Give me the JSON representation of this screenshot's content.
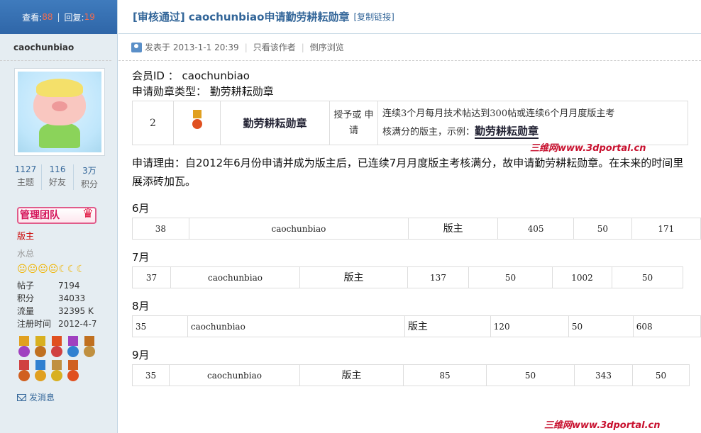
{
  "sidebar": {
    "views_label": "查看:",
    "views": "88",
    "replies_label": "回复:",
    "replies": "19",
    "username": "caochunbiao",
    "stats": [
      {
        "value": "1127",
        "label": "主题"
      },
      {
        "value": "116",
        "label": "好友"
      },
      {
        "value": "3万",
        "label": "积分"
      }
    ],
    "badge": "管理团队",
    "role": "版主",
    "group": "水总",
    "level_icons": "😐😐😐😐☾☾☾",
    "info": [
      {
        "label": "帖子",
        "value": "7194"
      },
      {
        "label": "积分",
        "value": "34033"
      },
      {
        "label": "流量",
        "value": "32395 K"
      },
      {
        "label": "注册时间",
        "value": "2012-4-7"
      }
    ],
    "send_message": "发消息",
    "medal_colors": [
      "#e0a020",
      "#d8b020",
      "#e05020",
      "#a040c0",
      "#c07020",
      "#d04040",
      "#3080d0",
      "#c09040",
      "#d06020"
    ]
  },
  "post": {
    "title": "[审核通过] caochunbiao申请勤劳耕耘勋章",
    "copy_link": "[复制链接]",
    "posted_at": "发表于 2013-1-1 20:39",
    "only_author": "只看该作者",
    "reverse": "倒序浏览",
    "member_id_label": "会员ID ：",
    "member_id": "caochunbiao",
    "medal_type_label": "申请勋章类型：",
    "medal_type": "勤劳耕耘勋章",
    "medal_row": {
      "no": "2",
      "name": "勤劳耕耘勋章",
      "method": "授予或 申请",
      "desc1": "连续3个月每月技术帖达到300帖或连续6个月月度版主考",
      "desc2": "核满分的版主，示例：",
      "example": "勤劳耕耘勋章"
    },
    "reason_line1": "申请理由：自2012年6月份申请并成为版主后，已连续7月月度版主考核满分，故申请勤劳耕耘勋章。在未来的时间里",
    "reason_line2": "展添砖加瓦。",
    "watermark": "三维网www.3dportal.cn",
    "months": [
      {
        "label": "6月",
        "cells": [
          "38",
          "caochunbiao",
          "版主",
          "405",
          "50",
          "171"
        ]
      },
      {
        "label": "7月",
        "cells": [
          "37",
          "caochunbiao",
          "版主",
          "137",
          "50",
          "1002",
          "50"
        ]
      },
      {
        "label": "8月",
        "cells": [
          "35",
          "caochunbiao",
          "版主",
          "120",
          "50",
          "608"
        ]
      },
      {
        "label": "9月",
        "cells": [
          "35",
          "caochunbiao",
          "版主",
          "85",
          "50",
          "343",
          "50"
        ]
      }
    ]
  }
}
